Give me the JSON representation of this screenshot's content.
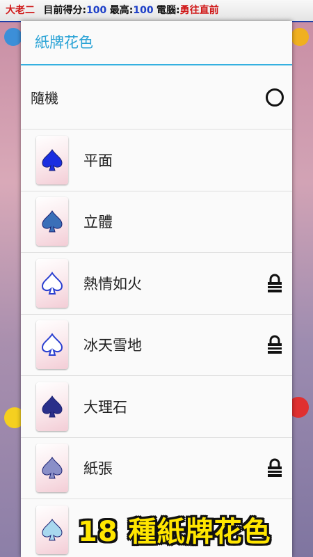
{
  "status_bar": {
    "player": "大老二",
    "score_label": "目前得分:",
    "score": "100",
    "high_label": "最高:",
    "high": "100",
    "computer_label": "電腦:",
    "computer_level": "勇往直前"
  },
  "dialog": {
    "title": "紙牌花色",
    "random_label": "隨機",
    "styles": [
      {
        "name": "平面",
        "locked": false,
        "color": "#1a2ee0"
      },
      {
        "name": "立體",
        "locked": false,
        "color": "#3a6fb8"
      },
      {
        "name": "熱情如火",
        "locked": true,
        "color": "#ffffff"
      },
      {
        "name": "冰天雪地",
        "locked": true,
        "color": "#ffffff"
      },
      {
        "name": "大理石",
        "locked": false,
        "color": "#2a2f8a"
      },
      {
        "name": "紙張",
        "locked": true,
        "color": "#8a8fc8"
      },
      {
        "name": "",
        "locked": false,
        "color": "#a8d8ee"
      }
    ]
  },
  "promo": {
    "text": "18 種紙牌花色"
  },
  "colors": {
    "accent": "#2aa3d6",
    "promo_yellow": "#ffe600"
  }
}
